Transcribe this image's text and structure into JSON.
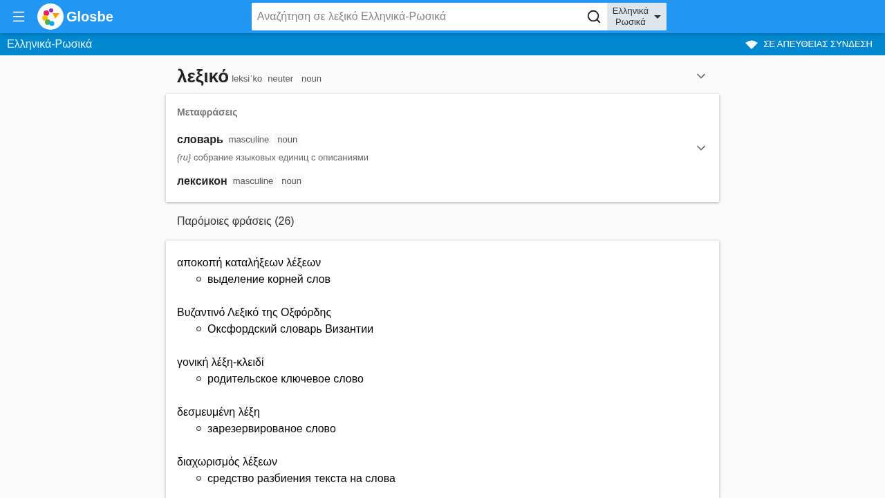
{
  "header": {
    "logo_text": "Glosbe",
    "search": {
      "placeholder": "Αναζήτηση σε λεξικό Ελληνικά-Ρωσικά"
    },
    "lang_from": "Ελληνικά",
    "lang_to": "Ρωσικά"
  },
  "subbar": {
    "title": "Ελληνικά-Ρωσικά",
    "status": "ΣΕ ΑΠΕΥΘΕΙΑΣ ΣΥΝΔΕΣΗ"
  },
  "entry": {
    "word": "λεξικό",
    "transcription": "leksiˈko",
    "tags": [
      "neuter",
      "noun"
    ]
  },
  "translations": {
    "heading": "Μεταφράσεις",
    "items": [
      {
        "word": "словарь",
        "tags": [
          "masculine",
          "noun"
        ],
        "lang": "{ru}",
        "description": "собрание языковых единиц с описаниями",
        "expandable": true
      },
      {
        "word": "лексикон",
        "tags": [
          "masculine",
          "noun"
        ],
        "expandable": false
      }
    ]
  },
  "phrases": {
    "heading": "Παρόμοιες φράσεις (26)",
    "items": [
      {
        "phrase": "αποκοπή καταλήξεων λέξεων",
        "translations": [
          "выделение корней слов"
        ]
      },
      {
        "phrase": "Βυζαντινό Λεξικό της Οξφόρδης",
        "translations": [
          "Оксфордский словарь Византии"
        ]
      },
      {
        "phrase": "γονική λέξη-κλειδί",
        "translations": [
          "родительское ключевое слово"
        ]
      },
      {
        "phrase": "δεσμευμένη λέξη",
        "translations": [
          "зарезервированое слово"
        ]
      },
      {
        "phrase": "διαχωρισμός λέξεων",
        "translations": [
          "средство разбиения текста на слова"
        ]
      }
    ]
  }
}
